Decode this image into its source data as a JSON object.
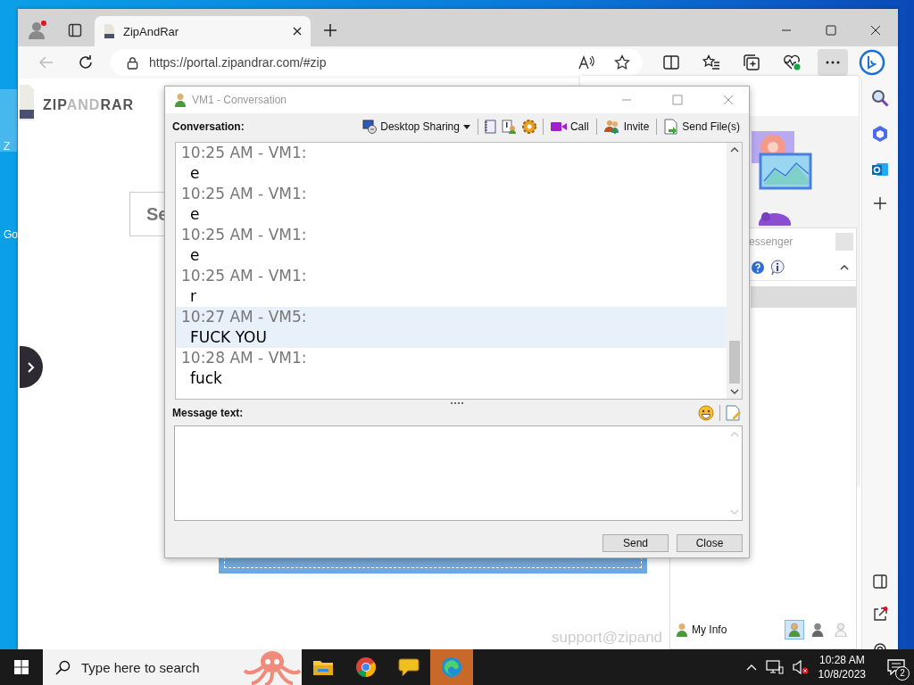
{
  "desktop_icons": [
    {
      "label": "Z"
    },
    {
      "label": "Go"
    }
  ],
  "browser": {
    "tab_title": "ZipAndRar",
    "url": "https://portal.zipandrar.com/#zip"
  },
  "page": {
    "logo_parts": [
      {
        "text": "ZIP",
        "muted": false
      },
      {
        "text": "AND",
        "muted": true
      },
      {
        "text": "RAR",
        "muted": false
      }
    ],
    "search_button": "Se",
    "support_text": "support@zipand"
  },
  "messenger": {
    "title": "essenger",
    "my_info": "My Info",
    "statuses": [
      {
        "selected": true
      },
      {
        "selected": false
      },
      {
        "selected": false
      }
    ]
  },
  "conversation": {
    "title": "VM1 - Conversation",
    "conversation_label": "Conversation:",
    "toolbar": [
      {
        "kind": "dropdown",
        "label": "Desktop Sharing"
      },
      {
        "kind": "button",
        "label": "Call"
      },
      {
        "kind": "button",
        "label": "Invite"
      },
      {
        "kind": "button",
        "label": "Send File(s)"
      }
    ],
    "messages": [
      {
        "header": "10:25 AM - VM1:",
        "text": "e",
        "selected": false
      },
      {
        "header": "10:25 AM - VM1:",
        "text": "e",
        "selected": false
      },
      {
        "header": "10:25 AM - VM1:",
        "text": "e",
        "selected": false
      },
      {
        "header": "10:25 AM - VM1:",
        "text": "r",
        "selected": false
      },
      {
        "header": "10:27 AM - VM5:",
        "text": "FUCK YOU",
        "selected": true
      },
      {
        "header": "10:28 AM - VM1:",
        "text": "fuck",
        "selected": false
      }
    ],
    "message_label": "Message text:",
    "buttons": [
      "Send",
      "Close"
    ]
  },
  "taskbar": {
    "search_placeholder": "Type here to search",
    "apps": [
      {
        "selected": false
      },
      {
        "selected": false
      },
      {
        "selected": false
      },
      {
        "selected": true
      }
    ],
    "time": "10:28 AM",
    "date": "10/8/2023",
    "notifications": "2"
  }
}
